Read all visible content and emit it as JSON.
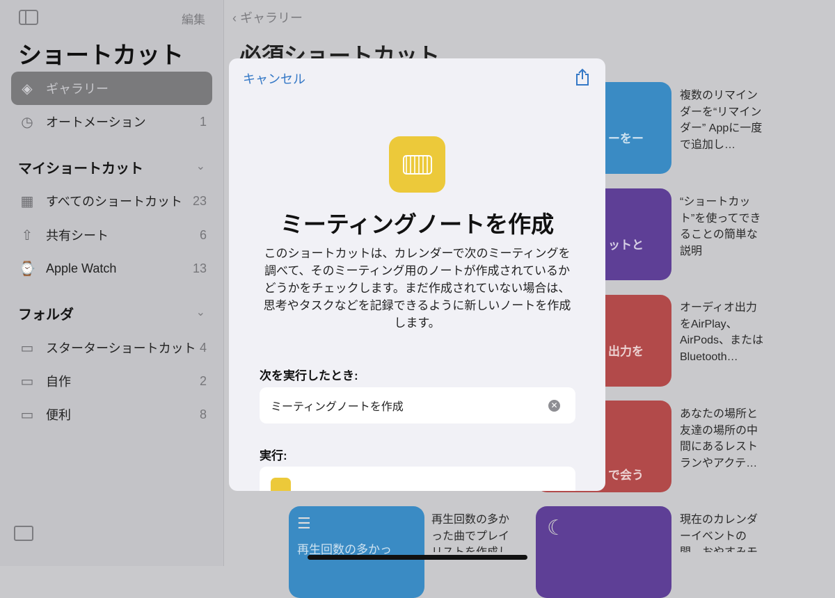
{
  "sidebar": {
    "edit": "編集",
    "title": "ショートカット",
    "items": [
      {
        "label": "ギャラリー",
        "count": ""
      },
      {
        "label": "オートメーション",
        "count": "1"
      }
    ],
    "my_section": "マイショートカット",
    "my_items": [
      {
        "label": "すべてのショートカット",
        "count": "23"
      },
      {
        "label": "共有シート",
        "count": "6"
      },
      {
        "label": "Apple Watch",
        "count": "13"
      }
    ],
    "folder_section": "フォルダ",
    "folders": [
      {
        "label": "スターターショートカット",
        "count": "4"
      },
      {
        "label": "自作",
        "count": "2"
      },
      {
        "label": "便利",
        "count": "8"
      }
    ]
  },
  "main": {
    "back": "ギャラリー",
    "title": "必須ショートカット",
    "cards": [
      {
        "title": "ーをー",
        "color": "#3a8bc4",
        "desc": "複数のリマインダーを“リマインダー” Appに一度で追加し…"
      },
      {
        "title": "ットと",
        "color": "#5e3f96",
        "desc": "“ショートカット”を使ってできることの簡単な説明"
      },
      {
        "title": "出力を",
        "color": "#b24a4a",
        "desc": "オーディオ出力をAirPlay、AirPods、またはBluetooth…"
      },
      {
        "title": "で会う",
        "color": "#b24a4a",
        "desc": "あなたの場所と友達の場所の中間にあるレストランやアクテ…"
      },
      {
        "title": "",
        "color": "#5e3f96",
        "desc": "現在のカレンダーイベントの間、おやすみモ"
      }
    ],
    "bottom_card": {
      "title": "再生回数の多かっ",
      "color": "#3a8bc4",
      "desc": "再生回数の多かった曲でプレイリストを作成し"
    }
  },
  "modal": {
    "cancel": "キャンセル",
    "title": "ミーティングノートを作成",
    "description": "このショートカットは、カレンダーで次のミーティングを調べて、そのミーティング用のノートが作成されているかどうかをチェックします。まだ作成されていない場合は、思考やタスクなどを記録できるように新しいノートを作成します。",
    "when_label": "次を実行したとき:",
    "when_value": "ミーティングノートを作成",
    "run_label": "実行:",
    "accent": "#ecc93a"
  }
}
